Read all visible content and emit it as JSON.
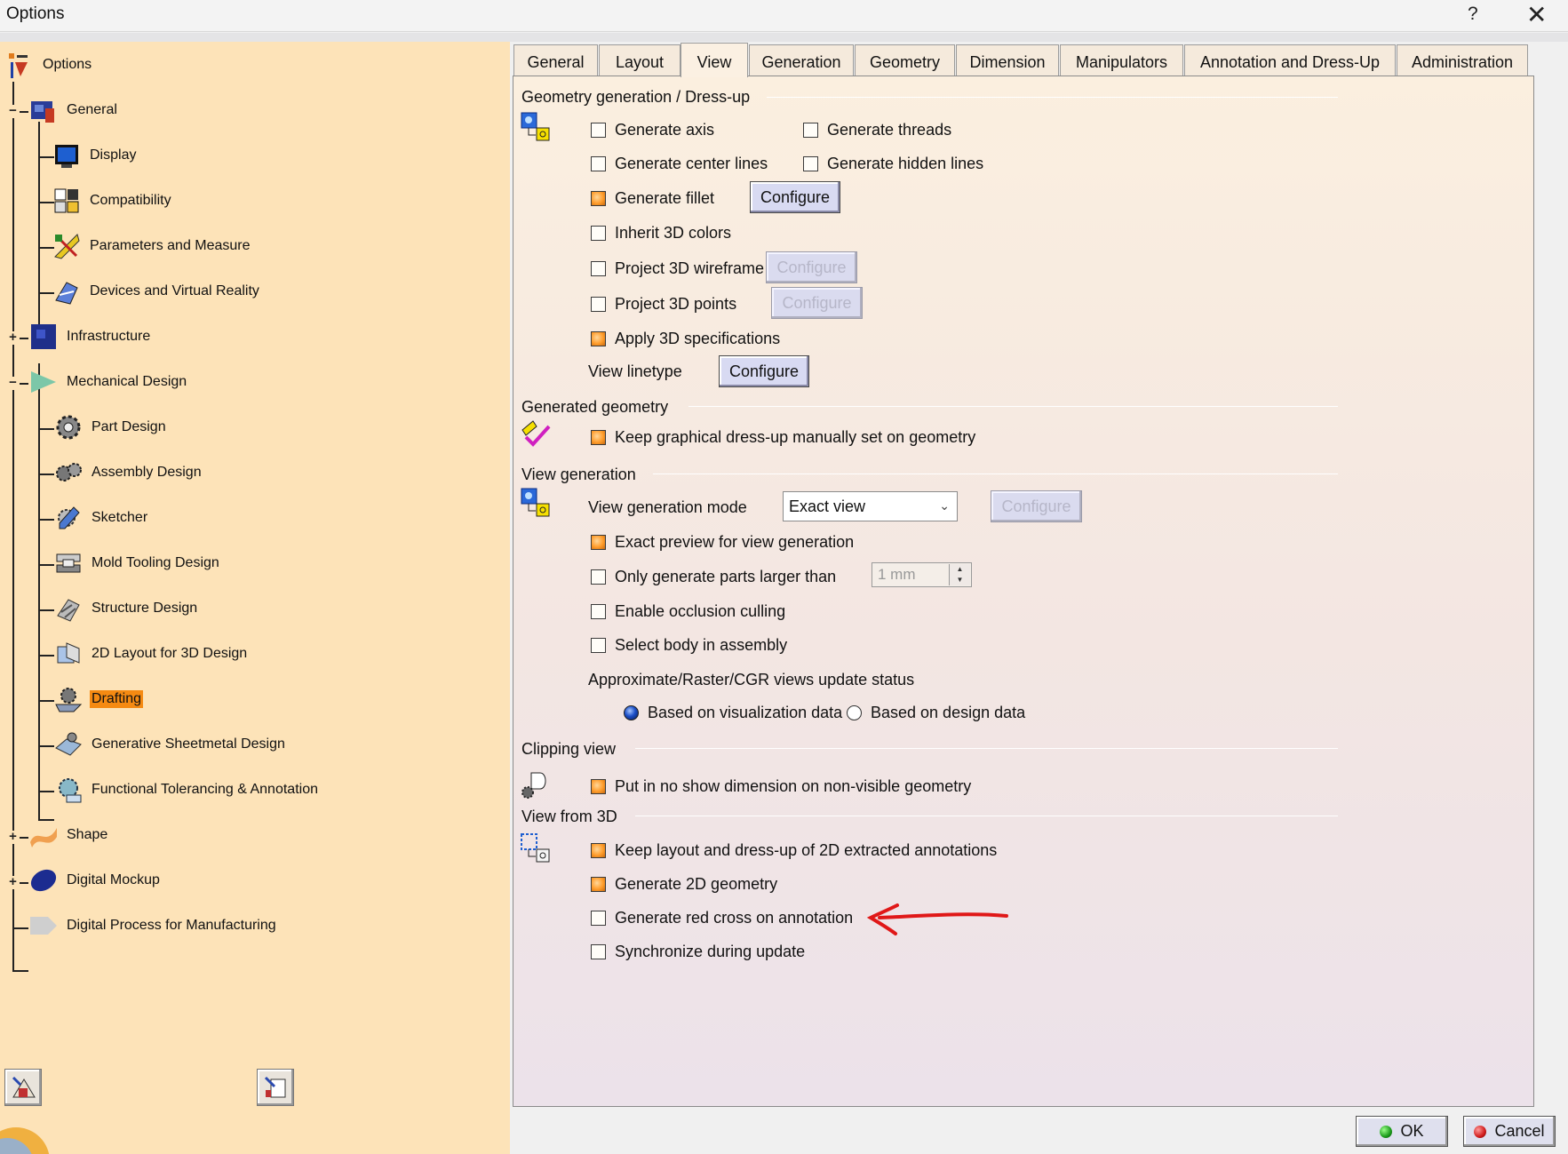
{
  "window": {
    "title": "Options",
    "help": "?",
    "close": "✕"
  },
  "tree": {
    "root": "Options",
    "general": "General",
    "display": "Display",
    "compatibility": "Compatibility",
    "parameters": "Parameters and Measure",
    "devices": "Devices and Virtual Reality",
    "infrastructure": "Infrastructure",
    "mechanical": "Mechanical Design",
    "part_design": "Part Design",
    "assembly_design": "Assembly Design",
    "sketcher": "Sketcher",
    "mold_tooling": "Mold Tooling Design",
    "structure": "Structure Design",
    "layout2d": "2D Layout for 3D Design",
    "drafting": "Drafting",
    "sheetmetal": "Generative Sheetmetal Design",
    "ftanda": "Functional Tolerancing & Annotation",
    "shape": "Shape",
    "digital_mockup": "Digital Mockup",
    "dpm": "Digital Process for Manufacturing",
    "selected": "Drafting"
  },
  "tabs": [
    "General",
    "Layout",
    "View",
    "Generation",
    "Geometry",
    "Dimension",
    "Manipulators",
    "Annotation and Dress-Up",
    "Administration"
  ],
  "active_tab": "View",
  "geom_dressup": {
    "title": "Geometry generation / Dress-up",
    "generate_axis": "Generate axis",
    "generate_threads": "Generate threads",
    "generate_center_lines": "Generate center lines",
    "generate_hidden_lines": "Generate hidden lines",
    "generate_fillet": "Generate fillet",
    "inherit_3d_colors": "Inherit 3D colors",
    "project_3d_wireframe": "Project 3D wireframe",
    "project_3d_points": "Project 3D points",
    "apply_3d_specs": "Apply 3D specifications",
    "view_linetype": "View linetype",
    "configure": "Configure"
  },
  "generated_geometry": {
    "title": "Generated geometry",
    "keep_graphical": "Keep graphical dress-up manually set on geometry"
  },
  "view_generation": {
    "title": "View generation",
    "mode_label": "View generation mode",
    "mode_value": "Exact view",
    "configure": "Configure",
    "exact_preview": "Exact preview for view generation",
    "only_larger": "Only generate parts larger than",
    "size_value": "1 mm",
    "occlusion": "Enable occlusion culling",
    "select_body": "Select body in assembly",
    "update_status": "Approximate/Raster/CGR views update status",
    "radio_vis": "Based on visualization data",
    "radio_design": "Based on design data"
  },
  "clipping": {
    "title": "Clipping view",
    "no_show": "Put in no show dimension on non-visible geometry"
  },
  "view_from_3d": {
    "title": "View from 3D",
    "keep_layout": "Keep layout and dress-up of 2D extracted annotations",
    "gen_2d_geometry": "Generate 2D geometry",
    "red_cross": "Generate red cross on annotation",
    "synchronize": "Synchronize during update"
  },
  "footer": {
    "ok": "OK",
    "cancel": "Cancel"
  },
  "colors": {
    "tree_bg": "#fde3b8",
    "selected": "#f58a12",
    "annotation_arrow": "#e01818"
  }
}
